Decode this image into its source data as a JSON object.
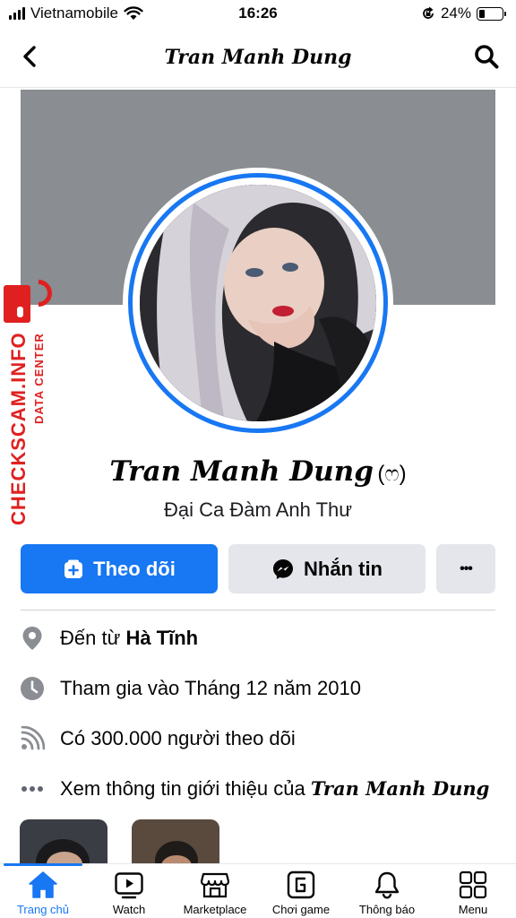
{
  "status_bar": {
    "carrier": "Vietnamobile",
    "time": "16:26",
    "battery_percent": "24%",
    "battery_level": 0.24,
    "icons": [
      "signal-icon",
      "wifi-icon",
      "orientation-lock-icon",
      "battery-icon"
    ]
  },
  "header": {
    "title": "Tran Manh Dung",
    "back_icon": "chevron-left-icon",
    "search_icon": "search-icon"
  },
  "watermark": {
    "site": "CHECKSCAM.INFO",
    "subtitle": "DATA CENTER"
  },
  "profile": {
    "name": "Tran Manh Dung",
    "nickname": "(ෆ)",
    "bio": "Đại Ca Đàm Anh Thư"
  },
  "actions": {
    "follow_label": "Theo dõi",
    "message_label": "Nhắn tin",
    "more_label": "•••"
  },
  "intro": {
    "from_prefix": "Đến từ ",
    "from_place": "Hà Tĩnh",
    "joined": "Tham gia vào Tháng 12 năm 2010",
    "followers": "Có 300.000 người theo dõi",
    "see_about_prefix": "Xem thông tin giới thiệu của ",
    "see_about_name": "Tran Manh Dung"
  },
  "bottom_nav": [
    {
      "label": "Trang chủ",
      "icon": "home-icon",
      "active": true
    },
    {
      "label": "Watch",
      "icon": "watch-icon",
      "active": false
    },
    {
      "label": "Marketplace",
      "icon": "marketplace-icon",
      "active": false
    },
    {
      "label": "Chơi game",
      "icon": "gaming-icon",
      "active": false
    },
    {
      "label": "Thông báo",
      "icon": "bell-icon",
      "active": false
    },
    {
      "label": "Menu",
      "icon": "menu-grid-icon",
      "active": false
    }
  ],
  "colors": {
    "accent": "#1877f2",
    "watermark": "#e02020",
    "cover": "#8a8d91",
    "button_secondary": "#e4e6eb"
  }
}
